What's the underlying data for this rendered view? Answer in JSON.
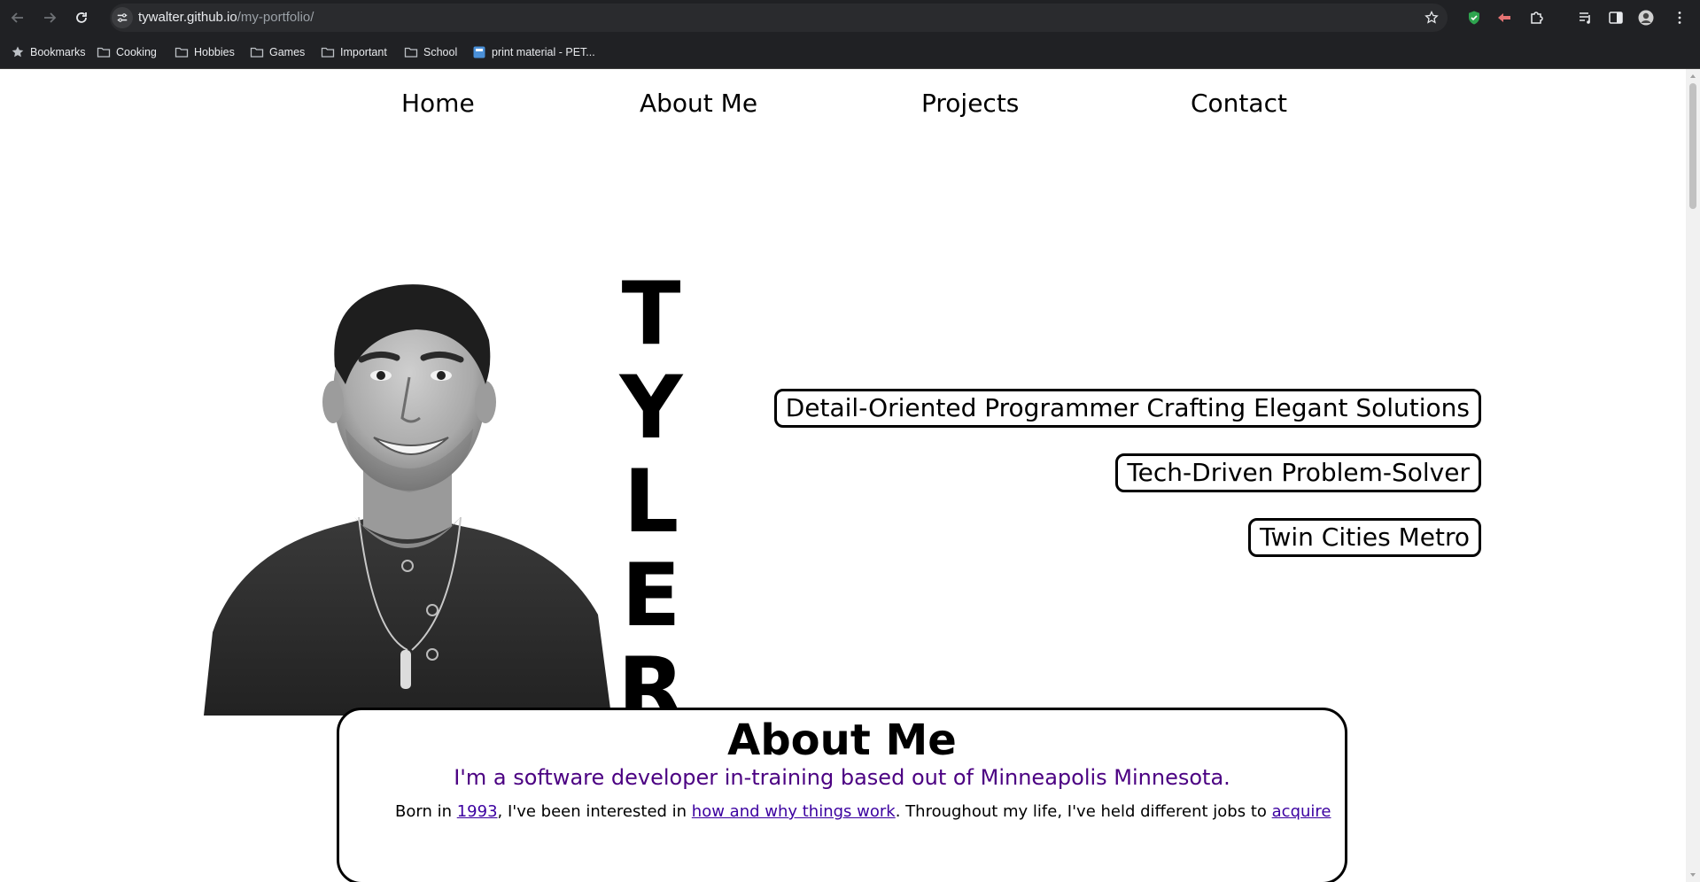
{
  "browser": {
    "url_host": "tywalter.github.io",
    "url_path": "/my-portfolio/",
    "bookmarks": [
      {
        "label": "Bookmarks",
        "icon": "star-icon"
      },
      {
        "label": "Cooking",
        "icon": "folder-icon"
      },
      {
        "label": "Hobbies",
        "icon": "folder-icon"
      },
      {
        "label": "Games",
        "icon": "folder-icon"
      },
      {
        "label": "Important",
        "icon": "folder-icon"
      },
      {
        "label": "School",
        "icon": "folder-icon"
      },
      {
        "label": "print material - PET...",
        "icon": "page-favicon-icon"
      }
    ]
  },
  "site_nav": {
    "home": "Home",
    "about": "About Me",
    "projects": "Projects",
    "contact": "Contact"
  },
  "hero": {
    "name_letters": [
      "T",
      "Y",
      "L",
      "E",
      "R"
    ],
    "taglines": [
      "Detail-Oriented Programmer Crafting Elegant Solutions",
      "Tech-Driven Problem-Solver",
      "Twin Cities Metro"
    ]
  },
  "about": {
    "title": "About Me",
    "subtitle": "I'm a software developer in-training based out of Minneapolis Minnesota.",
    "body_1": "Born in ",
    "body_link_1": "1993",
    "body_2": ", I've been interested in ",
    "body_link_2": "how and why things work",
    "body_3": ". Throughout my life, I've held different jobs to ",
    "body_link_3": "acquire"
  },
  "colors": {
    "chrome_bg": "#202124",
    "link_purple": "#4b0082",
    "text": "#000000"
  }
}
